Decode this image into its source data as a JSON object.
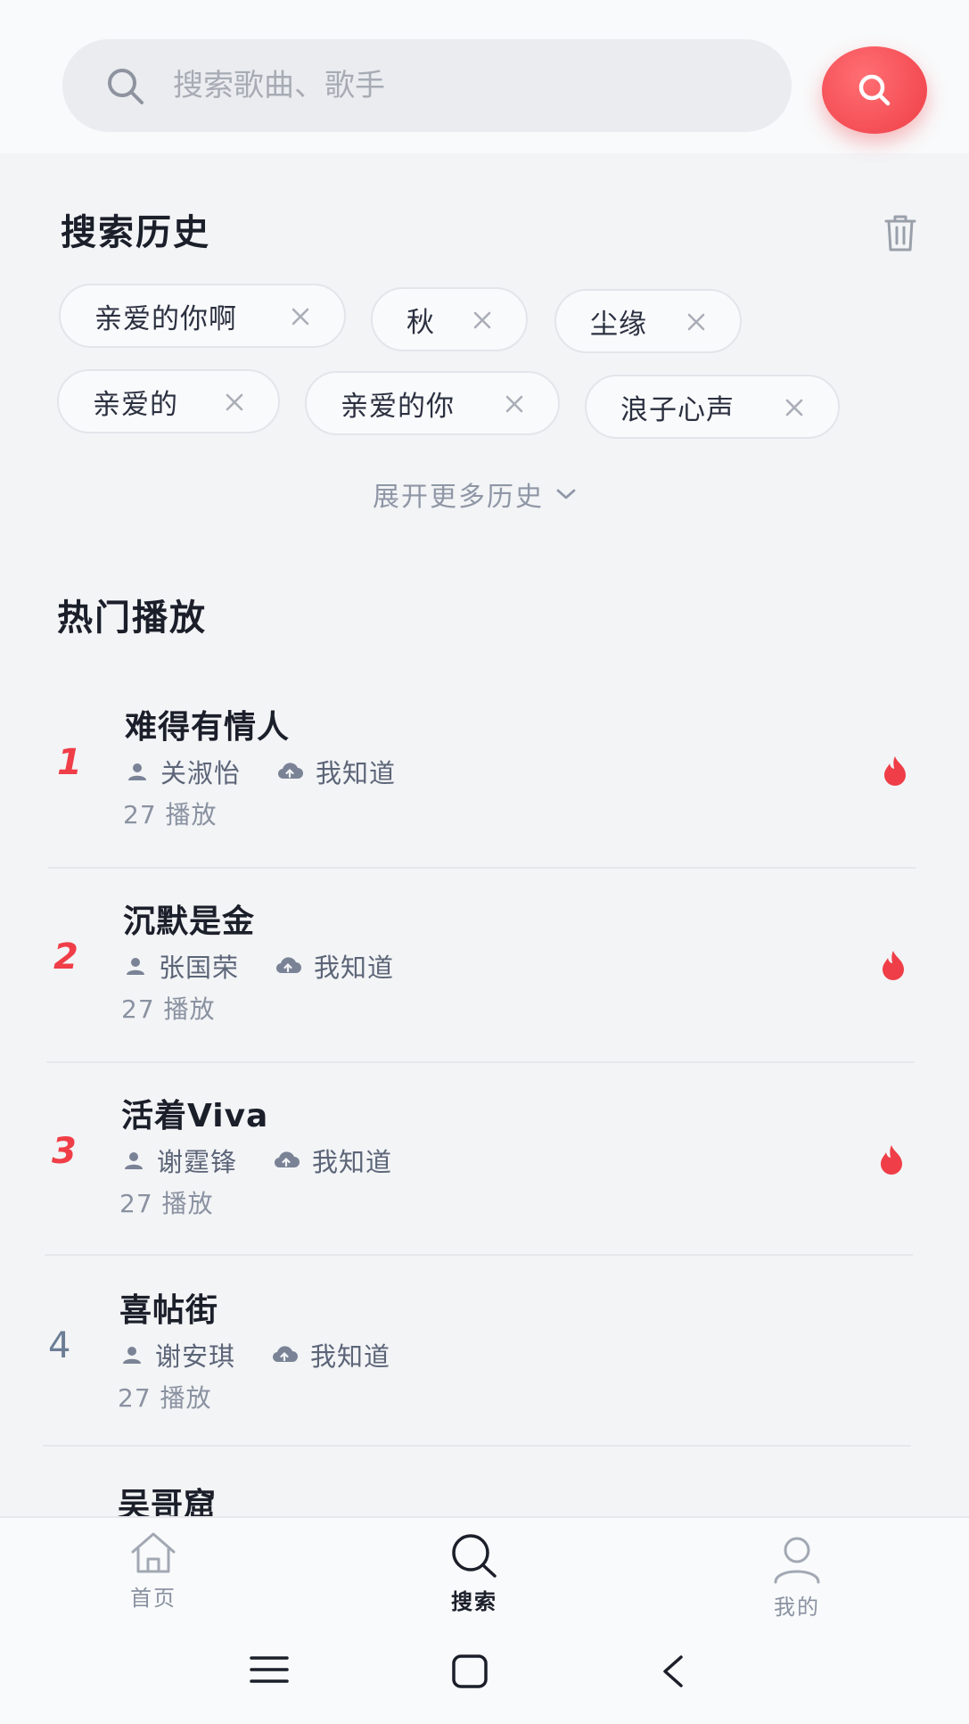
{
  "search": {
    "placeholder": "搜索歌曲、歌手"
  },
  "history": {
    "title": "搜索历史",
    "chips": [
      "亲爱的你啊",
      "秋",
      "尘缘",
      "亲爱的",
      "亲爱的你",
      "浪子心声"
    ],
    "expand_label": "展开更多历史"
  },
  "hot": {
    "title": "热门播放",
    "songs": [
      {
        "rank": "1",
        "title": "难得有情人",
        "artist": "关淑怡",
        "uploader": "我知道",
        "plays": "27 播放",
        "hot": true
      },
      {
        "rank": "2",
        "title": "沉默是金",
        "artist": "张国荣",
        "uploader": "我知道",
        "plays": "27 播放",
        "hot": true
      },
      {
        "rank": "3",
        "title": "活着Viva",
        "artist": "谢霆锋",
        "uploader": "我知道",
        "plays": "27 播放",
        "hot": true
      },
      {
        "rank": "4",
        "title": "喜帖街",
        "artist": "谢安琪",
        "uploader": "我知道",
        "plays": "27 播放",
        "hot": false
      },
      {
        "title": "吴哥窟"
      }
    ]
  },
  "nav": {
    "items": [
      {
        "label": "首页",
        "icon": "home-icon"
      },
      {
        "label": "搜索",
        "icon": "search-icon",
        "active": true
      },
      {
        "label": "我的",
        "icon": "user-icon"
      }
    ]
  },
  "colors": {
    "accent": "#ef3e47",
    "background": "#f3f4f6",
    "muted": "#8a92a1"
  }
}
